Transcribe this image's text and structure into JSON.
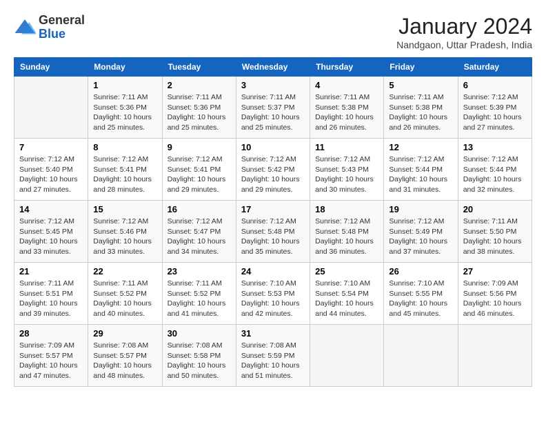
{
  "header": {
    "logo_line1": "General",
    "logo_line2": "Blue",
    "month_title": "January 2024",
    "subtitle": "Nandgaon, Uttar Pradesh, India"
  },
  "days_of_week": [
    "Sunday",
    "Monday",
    "Tuesday",
    "Wednesday",
    "Thursday",
    "Friday",
    "Saturday"
  ],
  "weeks": [
    [
      {
        "num": "",
        "info": ""
      },
      {
        "num": "1",
        "info": "Sunrise: 7:11 AM\nSunset: 5:36 PM\nDaylight: 10 hours\nand 25 minutes."
      },
      {
        "num": "2",
        "info": "Sunrise: 7:11 AM\nSunset: 5:36 PM\nDaylight: 10 hours\nand 25 minutes."
      },
      {
        "num": "3",
        "info": "Sunrise: 7:11 AM\nSunset: 5:37 PM\nDaylight: 10 hours\nand 25 minutes."
      },
      {
        "num": "4",
        "info": "Sunrise: 7:11 AM\nSunset: 5:38 PM\nDaylight: 10 hours\nand 26 minutes."
      },
      {
        "num": "5",
        "info": "Sunrise: 7:11 AM\nSunset: 5:38 PM\nDaylight: 10 hours\nand 26 minutes."
      },
      {
        "num": "6",
        "info": "Sunrise: 7:12 AM\nSunset: 5:39 PM\nDaylight: 10 hours\nand 27 minutes."
      }
    ],
    [
      {
        "num": "7",
        "info": "Sunrise: 7:12 AM\nSunset: 5:40 PM\nDaylight: 10 hours\nand 27 minutes."
      },
      {
        "num": "8",
        "info": "Sunrise: 7:12 AM\nSunset: 5:41 PM\nDaylight: 10 hours\nand 28 minutes."
      },
      {
        "num": "9",
        "info": "Sunrise: 7:12 AM\nSunset: 5:41 PM\nDaylight: 10 hours\nand 29 minutes."
      },
      {
        "num": "10",
        "info": "Sunrise: 7:12 AM\nSunset: 5:42 PM\nDaylight: 10 hours\nand 29 minutes."
      },
      {
        "num": "11",
        "info": "Sunrise: 7:12 AM\nSunset: 5:43 PM\nDaylight: 10 hours\nand 30 minutes."
      },
      {
        "num": "12",
        "info": "Sunrise: 7:12 AM\nSunset: 5:44 PM\nDaylight: 10 hours\nand 31 minutes."
      },
      {
        "num": "13",
        "info": "Sunrise: 7:12 AM\nSunset: 5:44 PM\nDaylight: 10 hours\nand 32 minutes."
      }
    ],
    [
      {
        "num": "14",
        "info": "Sunrise: 7:12 AM\nSunset: 5:45 PM\nDaylight: 10 hours\nand 33 minutes."
      },
      {
        "num": "15",
        "info": "Sunrise: 7:12 AM\nSunset: 5:46 PM\nDaylight: 10 hours\nand 33 minutes."
      },
      {
        "num": "16",
        "info": "Sunrise: 7:12 AM\nSunset: 5:47 PM\nDaylight: 10 hours\nand 34 minutes."
      },
      {
        "num": "17",
        "info": "Sunrise: 7:12 AM\nSunset: 5:48 PM\nDaylight: 10 hours\nand 35 minutes."
      },
      {
        "num": "18",
        "info": "Sunrise: 7:12 AM\nSunset: 5:48 PM\nDaylight: 10 hours\nand 36 minutes."
      },
      {
        "num": "19",
        "info": "Sunrise: 7:12 AM\nSunset: 5:49 PM\nDaylight: 10 hours\nand 37 minutes."
      },
      {
        "num": "20",
        "info": "Sunrise: 7:11 AM\nSunset: 5:50 PM\nDaylight: 10 hours\nand 38 minutes."
      }
    ],
    [
      {
        "num": "21",
        "info": "Sunrise: 7:11 AM\nSunset: 5:51 PM\nDaylight: 10 hours\nand 39 minutes."
      },
      {
        "num": "22",
        "info": "Sunrise: 7:11 AM\nSunset: 5:52 PM\nDaylight: 10 hours\nand 40 minutes."
      },
      {
        "num": "23",
        "info": "Sunrise: 7:11 AM\nSunset: 5:52 PM\nDaylight: 10 hours\nand 41 minutes."
      },
      {
        "num": "24",
        "info": "Sunrise: 7:10 AM\nSunset: 5:53 PM\nDaylight: 10 hours\nand 42 minutes."
      },
      {
        "num": "25",
        "info": "Sunrise: 7:10 AM\nSunset: 5:54 PM\nDaylight: 10 hours\nand 44 minutes."
      },
      {
        "num": "26",
        "info": "Sunrise: 7:10 AM\nSunset: 5:55 PM\nDaylight: 10 hours\nand 45 minutes."
      },
      {
        "num": "27",
        "info": "Sunrise: 7:09 AM\nSunset: 5:56 PM\nDaylight: 10 hours\nand 46 minutes."
      }
    ],
    [
      {
        "num": "28",
        "info": "Sunrise: 7:09 AM\nSunset: 5:57 PM\nDaylight: 10 hours\nand 47 minutes."
      },
      {
        "num": "29",
        "info": "Sunrise: 7:08 AM\nSunset: 5:57 PM\nDaylight: 10 hours\nand 48 minutes."
      },
      {
        "num": "30",
        "info": "Sunrise: 7:08 AM\nSunset: 5:58 PM\nDaylight: 10 hours\nand 50 minutes."
      },
      {
        "num": "31",
        "info": "Sunrise: 7:08 AM\nSunset: 5:59 PM\nDaylight: 10 hours\nand 51 minutes."
      },
      {
        "num": "",
        "info": ""
      },
      {
        "num": "",
        "info": ""
      },
      {
        "num": "",
        "info": ""
      }
    ]
  ]
}
